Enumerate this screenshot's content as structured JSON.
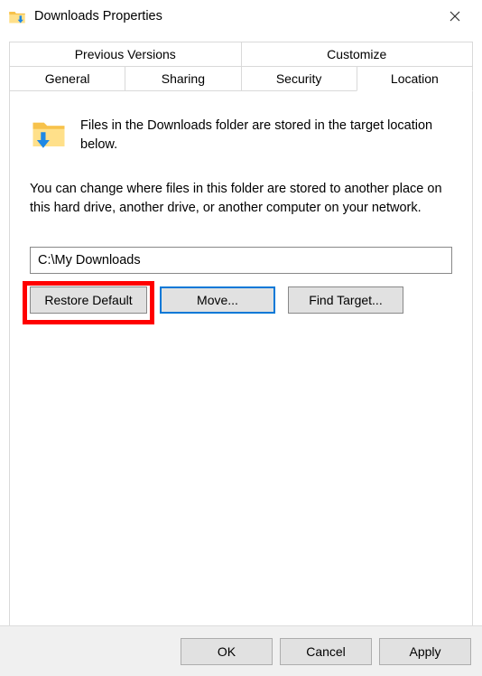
{
  "window": {
    "title": "Downloads Properties"
  },
  "tabs": {
    "row1": [
      "Previous Versions",
      "Customize"
    ],
    "row2": [
      "General",
      "Sharing",
      "Security",
      "Location"
    ],
    "active": "Location"
  },
  "content": {
    "intro": "Files in the Downloads folder are stored in the target location below.",
    "description": "You can change where files in this folder are stored to another place on this hard drive, another drive, or another computer on your network.",
    "path_value": "C:\\My Downloads"
  },
  "buttons": {
    "restore": "Restore Default",
    "move": "Move...",
    "find_target": "Find Target..."
  },
  "footer": {
    "ok": "OK",
    "cancel": "Cancel",
    "apply": "Apply"
  }
}
